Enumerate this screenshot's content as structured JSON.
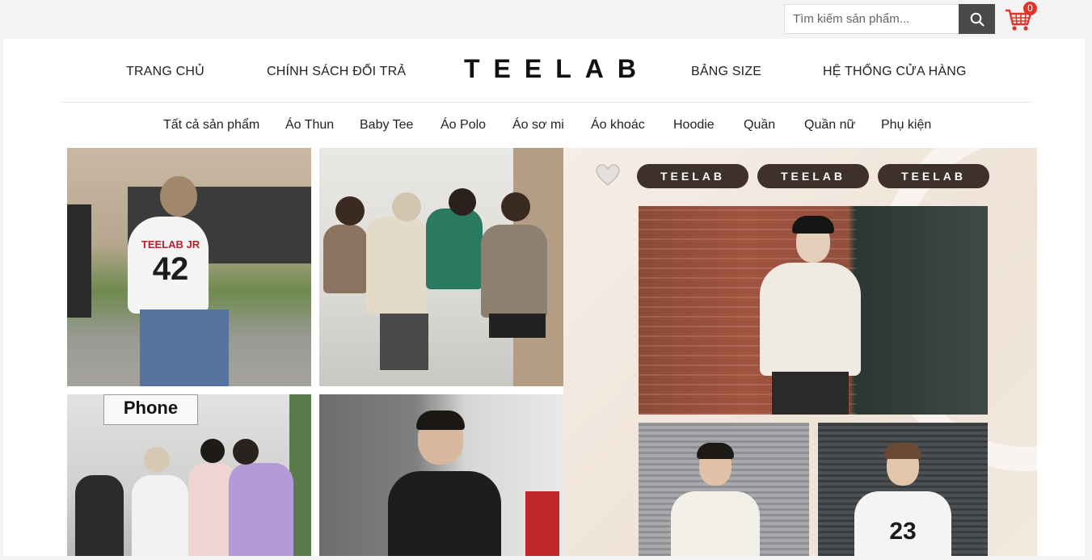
{
  "search": {
    "placeholder": "Tìm kiếm sản phẩm..."
  },
  "cart": {
    "count": "0"
  },
  "logo": "TEELAB",
  "main_nav": [
    "TRANG CHỦ",
    "CHÍNH SÁCH ĐỔI TRẢ",
    "BẢNG SIZE",
    "HỆ THỐNG CỬA HÀNG"
  ],
  "categories": [
    "Tất cả sản phẩm",
    "Áo Thun",
    "Baby Tee",
    "Áo Polo",
    "Áo sơ mi",
    "Áo khoác",
    "Hoodie",
    "Quần",
    "Quần nữ",
    "Phụ kiện"
  ],
  "banner": {
    "pills": [
      "TEELAB",
      "TEELAB",
      "TEELAB"
    ]
  },
  "photo_text": {
    "jersey_brand": "TEELAB JR",
    "jersey_number": "42",
    "sign": "Phone",
    "jersey_number_2": "23"
  },
  "colors": {
    "accent": "#e0342b",
    "search_button": "#4a4a4a",
    "pill": "#3e302b"
  }
}
